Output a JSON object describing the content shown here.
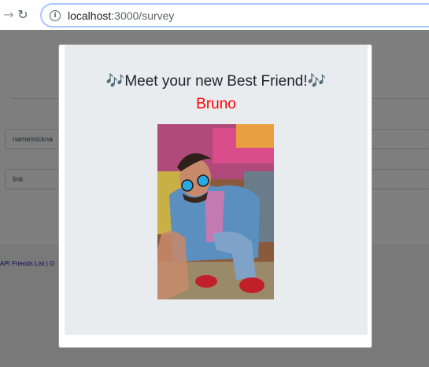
{
  "browser": {
    "url_host": "localhost",
    "url_path": ":3000/survey"
  },
  "page": {
    "field_name_placeholder": "name/nickna",
    "field_link_placeholder": "link",
    "footer_link": "API Friends List | G"
  },
  "modal": {
    "title": "🎶Meet your new Best Friend!🎶",
    "friend_name": "Bruno",
    "photo_icon": "friend-photo"
  },
  "colors": {
    "friend_name": "#ff0000",
    "modal_body": "#e9ecef",
    "omnibox_border": "#a8c7fa"
  }
}
